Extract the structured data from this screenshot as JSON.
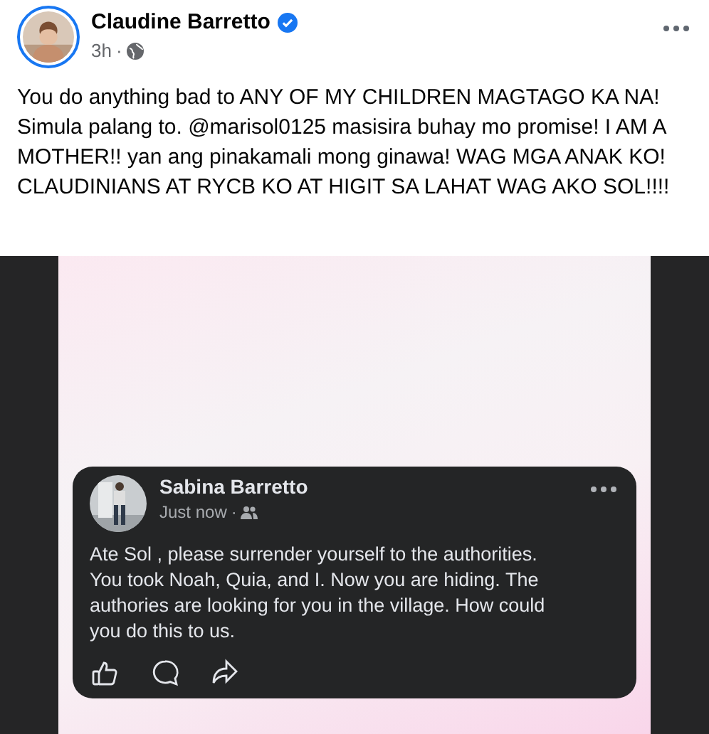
{
  "post": {
    "author": "Claudine Barretto",
    "verified": true,
    "time": "3h",
    "separator": "·",
    "text_lines": [
      "You do anything bad to ANY OF MY CHILDREN MAGTAGO KA NA!",
      "Simula palang to. @marisol0125 masisira buhay mo promise! I AM A",
      "MOTHER!! yan ang pinakamali mong ginawa! WAG MGA ANAK KO!",
      "CLAUDINIANS AT RYCB KO AT HIGIT SA LAHAT WAG AKO SOL!!!!"
    ]
  },
  "embedded_post": {
    "author": "Sabina Barretto",
    "time": "Just now",
    "separator": "·",
    "text_lines": [
      "Ate Sol , please surrender yourself to the authorities.",
      "You took Noah, Quia, and I. Now you are hiding. The",
      "authories are looking for you in the village. How could",
      "you do this to us."
    ]
  }
}
